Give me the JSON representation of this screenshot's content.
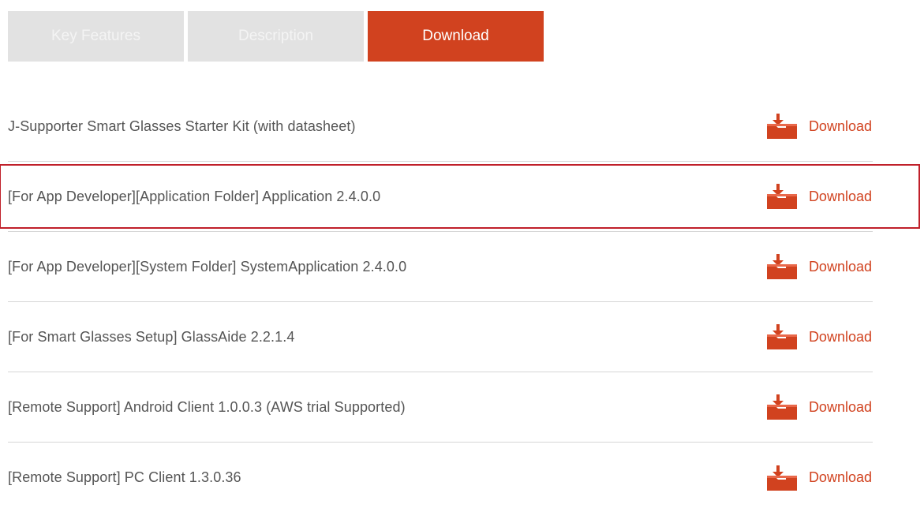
{
  "tabs": [
    {
      "label": "Key Features",
      "active": false
    },
    {
      "label": "Description",
      "active": false
    },
    {
      "label": "Download",
      "active": true
    }
  ],
  "downloads": [
    {
      "title": "J-Supporter Smart Glasses Starter Kit (with datasheet)",
      "action": "Download"
    },
    {
      "title": "[For App Developer][Application Folder] Application 2.4.0.0",
      "action": "Download"
    },
    {
      "title": "[For App Developer][System Folder] SystemApplication 2.4.0.0",
      "action": "Download"
    },
    {
      "title": "[For Smart Glasses Setup] GlassAide 2.2.1.4",
      "action": "Download"
    },
    {
      "title": "[Remote Support] Android Client 1.0.0.3 (AWS trial Supported)",
      "action": "Download"
    },
    {
      "title": "[Remote Support] PC Client 1.3.0.36",
      "action": "Download"
    }
  ],
  "colors": {
    "accent": "#d1421f",
    "inactive_tab": "#e2e2e2",
    "highlight_border": "#c0202a",
    "text": "#555555"
  },
  "icons": {
    "download": "download-tray-icon"
  }
}
